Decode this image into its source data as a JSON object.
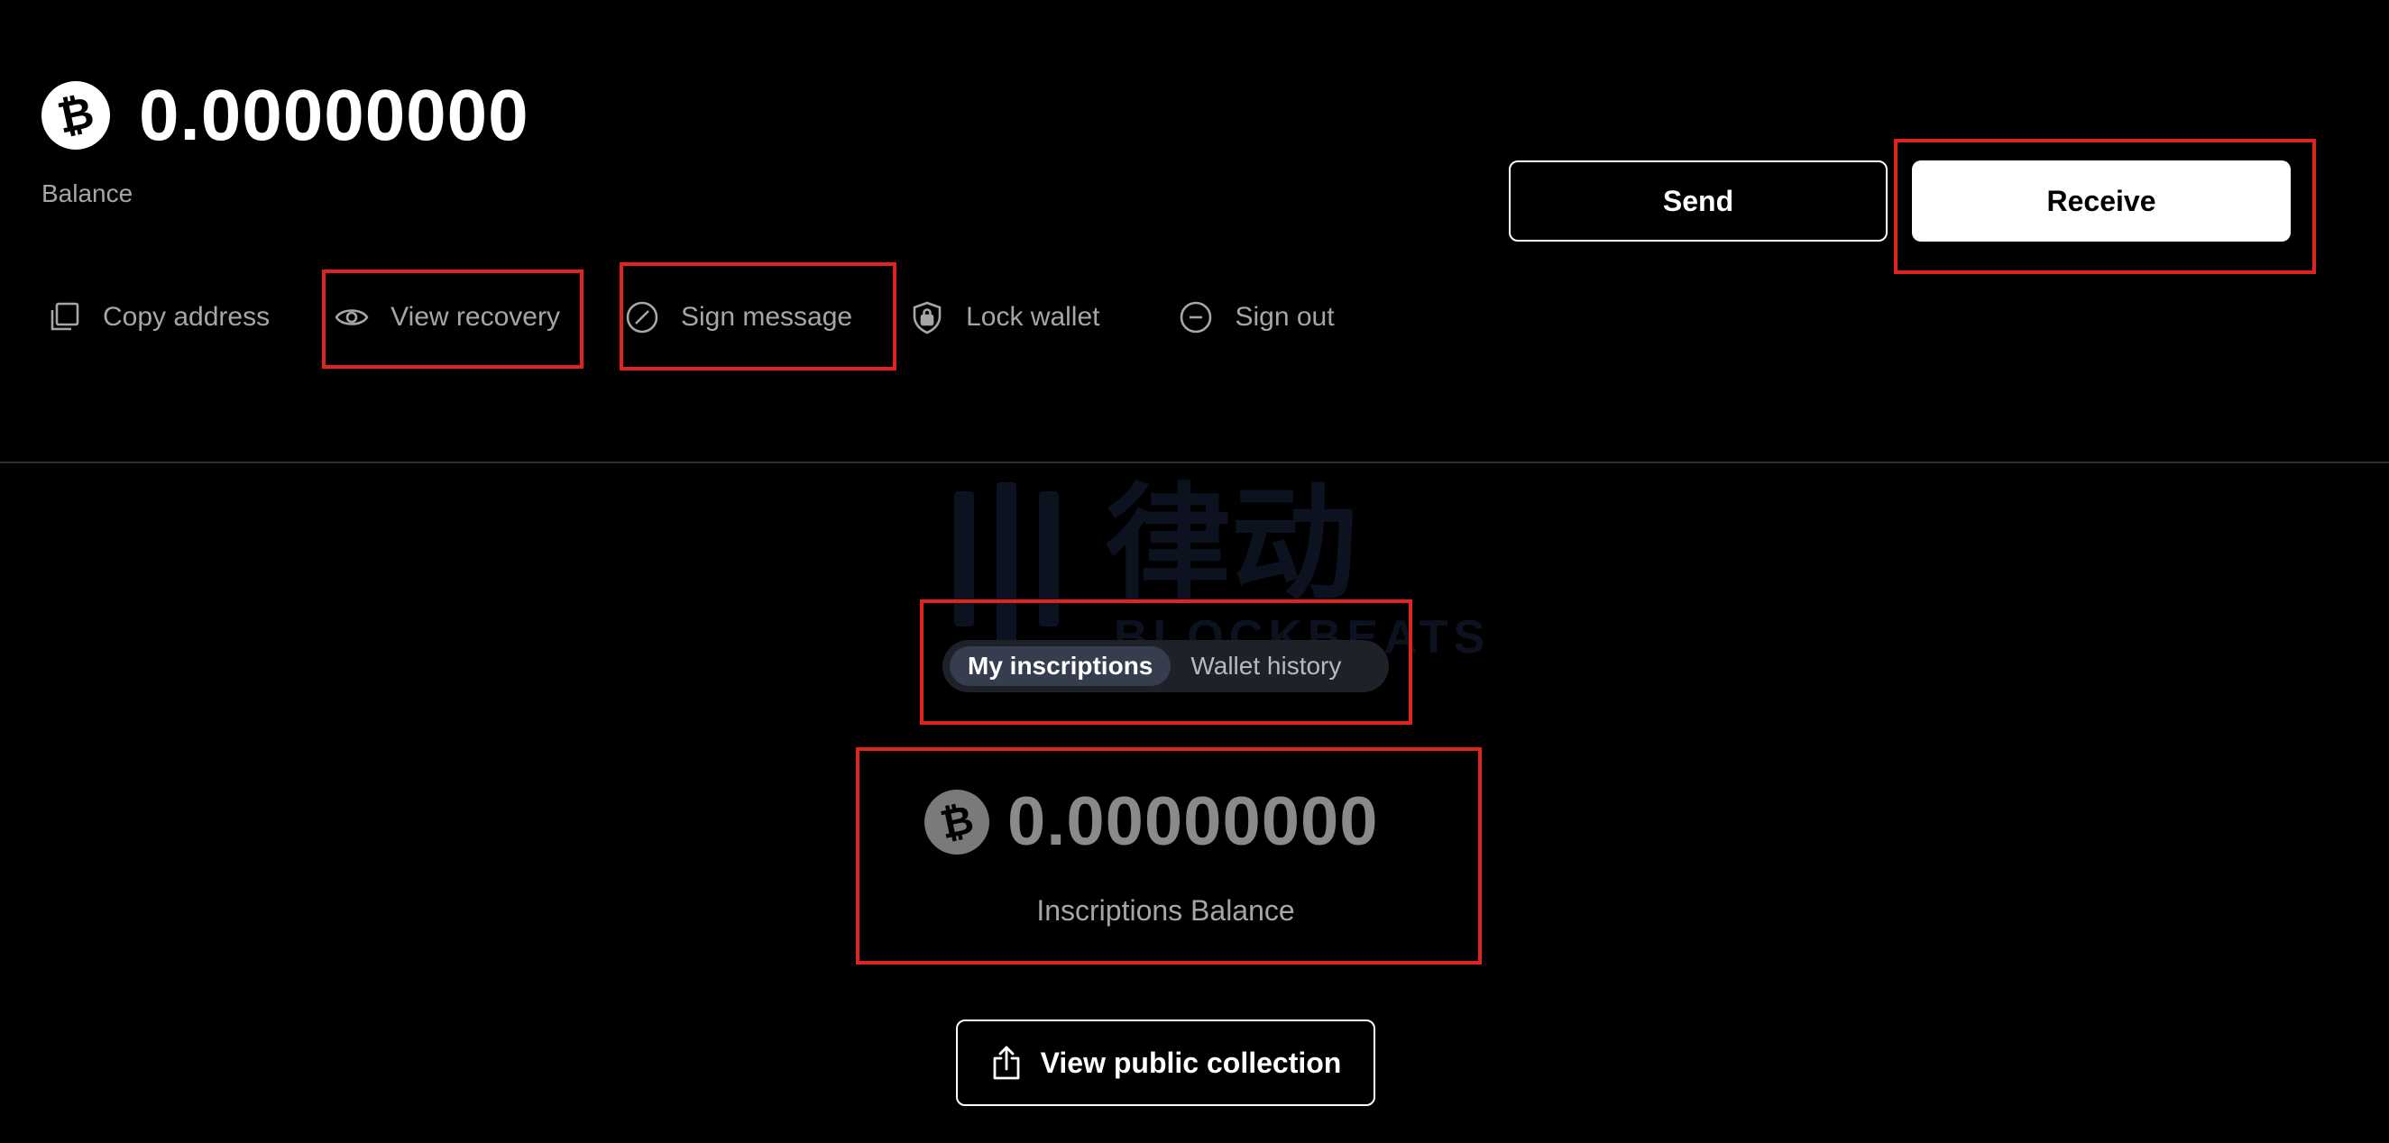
{
  "wallet": {
    "balance": "0.00000000",
    "balance_label": "Balance",
    "currency_icon": "bitcoin-icon"
  },
  "actions": {
    "copy_address": "Copy address",
    "view_recovery": "View recovery",
    "sign_message": "Sign message",
    "lock_wallet": "Lock wallet",
    "sign_out": "Sign out"
  },
  "buttons": {
    "send": "Send",
    "receive": "Receive",
    "view_public_collection": "View public collection"
  },
  "tabs": [
    {
      "label": "My inscriptions",
      "active": true
    },
    {
      "label": "Wallet history",
      "active": false
    }
  ],
  "inscriptions": {
    "balance": "0.00000000",
    "label": "Inscriptions Balance"
  },
  "watermark": {
    "cjk": "律动",
    "latin": "BLOCKBEATS"
  },
  "colors": {
    "background": "#000000",
    "highlight": "#e0231d",
    "tab_track": "#1e2128",
    "tab_active": "#353d4f",
    "muted_text": "#a6a6a6"
  }
}
